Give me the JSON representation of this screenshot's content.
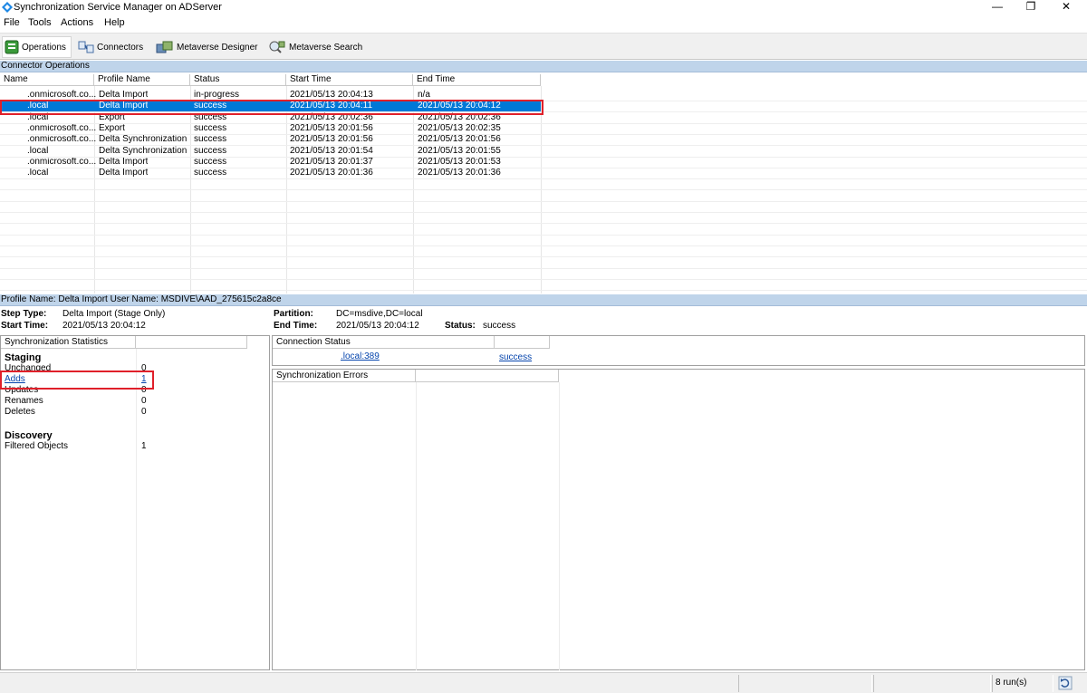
{
  "window": {
    "title": "Synchronization Service Manager on ADServer",
    "minimize": "—",
    "restore": "❐",
    "close": "✕"
  },
  "menu": [
    "File",
    "Tools",
    "Actions",
    "Help"
  ],
  "toolbar": {
    "operations": "Operations",
    "connectors": "Connectors",
    "metaverse_designer": "Metaverse Designer",
    "metaverse_search": "Metaverse Search"
  },
  "operations": {
    "section_title": "Connector Operations",
    "columns": [
      "Name",
      "Profile Name",
      "Status",
      "Start Time",
      "End Time"
    ],
    "rows": [
      {
        "name": ".onmicrosoft.co...",
        "profile": "Delta Import",
        "status": "in-progress",
        "start": "2021/05/13 20:04:13",
        "end": "n/a",
        "selected": false
      },
      {
        "name": ".local",
        "profile": "Delta Import",
        "status": "success",
        "start": "2021/05/13 20:04:11",
        "end": "2021/05/13 20:04:12",
        "selected": true
      },
      {
        "name": ".local",
        "profile": "Export",
        "status": "success",
        "start": "2021/05/13 20:02:36",
        "end": "2021/05/13 20:02:36",
        "selected": false
      },
      {
        "name": ".onmicrosoft.co...",
        "profile": "Export",
        "status": "success",
        "start": "2021/05/13 20:01:56",
        "end": "2021/05/13 20:02:35",
        "selected": false
      },
      {
        "name": ".onmicrosoft.co...",
        "profile": "Delta Synchronization",
        "status": "success",
        "start": "2021/05/13 20:01:56",
        "end": "2021/05/13 20:01:56",
        "selected": false
      },
      {
        "name": ".local",
        "profile": "Delta Synchronization",
        "status": "success",
        "start": "2021/05/13 20:01:54",
        "end": "2021/05/13 20:01:55",
        "selected": false
      },
      {
        "name": ".onmicrosoft.co...",
        "profile": "Delta Import",
        "status": "success",
        "start": "2021/05/13 20:01:37",
        "end": "2021/05/13 20:01:53",
        "selected": false
      },
      {
        "name": ".local",
        "profile": "Delta Import",
        "status": "success",
        "start": "2021/05/13 20:01:36",
        "end": "2021/05/13 20:01:36",
        "selected": false
      }
    ]
  },
  "details": {
    "header": "Profile Name: Delta Import  User Name: MSDIVE\\AAD_275615c2a8ce",
    "step_type_label": "Step Type:",
    "step_type": "Delta Import (Stage Only)",
    "start_time_label": "Start Time:",
    "start_time": "2021/05/13 20:04:12",
    "partition_label": "Partition:",
    "partition": "DC=msdive,DC=local",
    "end_time_label": "End Time:",
    "end_time": "2021/05/13 20:04:12",
    "status_label": "Status:",
    "status": "success"
  },
  "sync_stats": {
    "header": "Synchronization Statistics",
    "staging_title": "Staging",
    "staging": [
      {
        "label": "Unchanged",
        "value": "0"
      },
      {
        "label": "Adds",
        "value": "1"
      },
      {
        "label": "Updates",
        "value": "0"
      },
      {
        "label": "Renames",
        "value": "0"
      },
      {
        "label": "Deletes",
        "value": "0"
      }
    ],
    "discovery_title": "Discovery",
    "discovery": [
      {
        "label": "Filtered Objects",
        "value": "1"
      }
    ]
  },
  "connection_status": {
    "header": "Connection Status",
    "server": ".local:389",
    "result": "success"
  },
  "sync_errors": {
    "header": "Synchronization Errors"
  },
  "statusbar": {
    "runs": "8 run(s)"
  }
}
